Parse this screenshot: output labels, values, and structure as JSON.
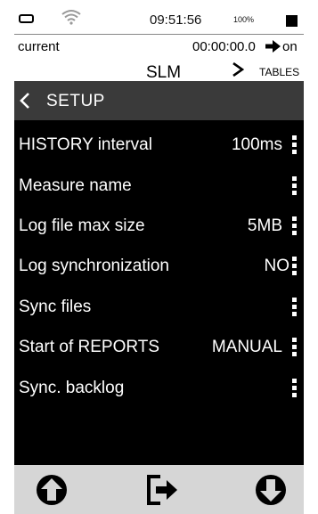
{
  "status_bar": {
    "time": "09:51:56",
    "battery_percent": "100%",
    "icons": [
      "battery-icon",
      "wifi-icon",
      "stop-square-icon"
    ]
  },
  "info_row": {
    "left_text": "current",
    "timer": "00:00:00.0",
    "arrow_icon": "right-arrow-icon",
    "state": "on"
  },
  "nav": {
    "title": "SLM",
    "next_icon": "chevron-right-icon",
    "next_label": "TABLES"
  },
  "setup": {
    "back_icon": "chevron-left-icon",
    "title": "SETUP"
  },
  "settings": [
    {
      "label": "HISTORY interval",
      "value": "100ms"
    },
    {
      "label": "Measure name",
      "value": ""
    },
    {
      "label": "Log file max size",
      "value": "5MB"
    },
    {
      "label": "Log synchronization",
      "value": "NO"
    },
    {
      "label": "Sync files",
      "value": ""
    },
    {
      "label": "Start of REPORTS",
      "value": "MANUAL"
    },
    {
      "label": "Sync. backlog",
      "value": ""
    }
  ],
  "bottom_bar": {
    "buttons": [
      "arrow-up-circle-icon",
      "exit-icon",
      "arrow-down-circle-icon"
    ]
  },
  "colors": {
    "background": "#000000",
    "header": "#3a3a3a",
    "bottom_bar": "#d6d6d6",
    "text": "#ffffff"
  }
}
